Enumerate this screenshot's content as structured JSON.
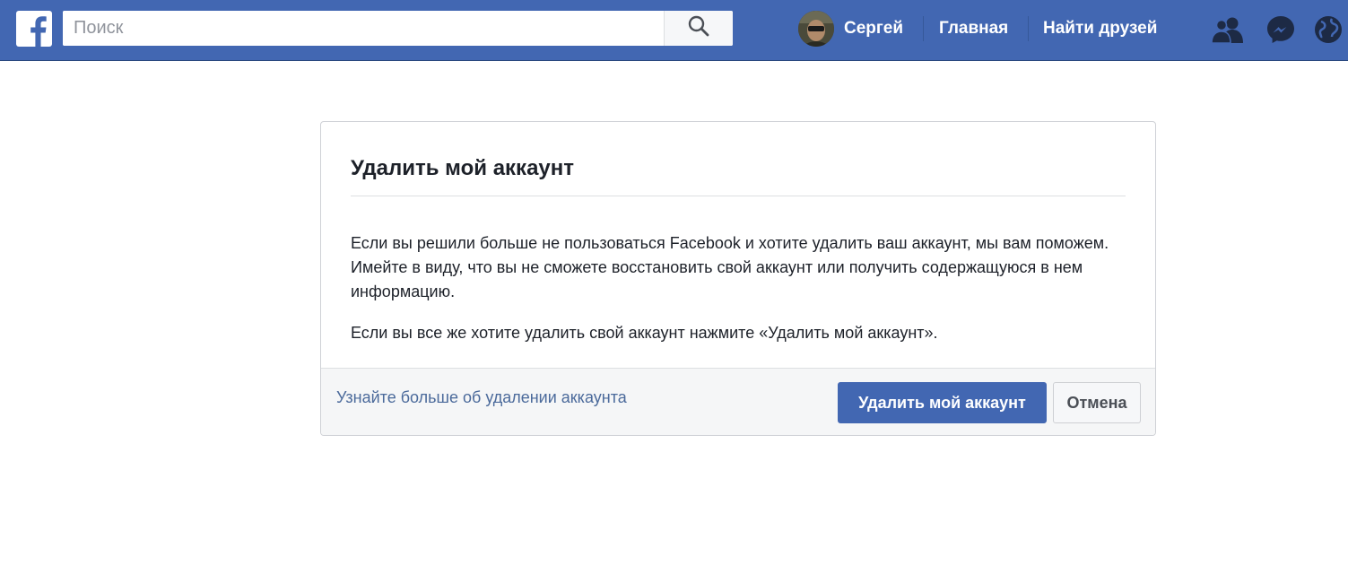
{
  "topbar": {
    "logo_icon": "facebook-f-icon",
    "search": {
      "placeholder": "Поиск",
      "value": "",
      "button_icon": "magnifier-icon"
    },
    "user": {
      "name": "Сергей",
      "avatar_icon": "user-avatar"
    },
    "links": [
      {
        "label": "Главная"
      },
      {
        "label": "Найти друзей"
      }
    ],
    "icons": [
      "friend-requests-icon",
      "messenger-icon",
      "notifications-globe-icon"
    ],
    "colors": {
      "bar": "#4267b2",
      "text": "#ffffff"
    }
  },
  "dialog": {
    "title": "Удалить мой аккаунт",
    "paragraph1": "Если вы решили больше не пользоваться Facebook и хотите удалить ваш аккаунт, мы вам поможем. Имейте в виду, что вы не сможете восстановить свой аккаунт или получить содержащуюся в нем информацию.",
    "paragraph2": "Если вы все же хотите удалить свой аккаунт нажмите «Удалить мой аккаунт».",
    "learn_more_link": "Узнайте больше об удалении аккаунта",
    "delete_button": "Удалить мой аккаунт",
    "cancel_button": "Отмена",
    "colors": {
      "primary": "#4267b2",
      "link": "#4b6a9b"
    }
  }
}
